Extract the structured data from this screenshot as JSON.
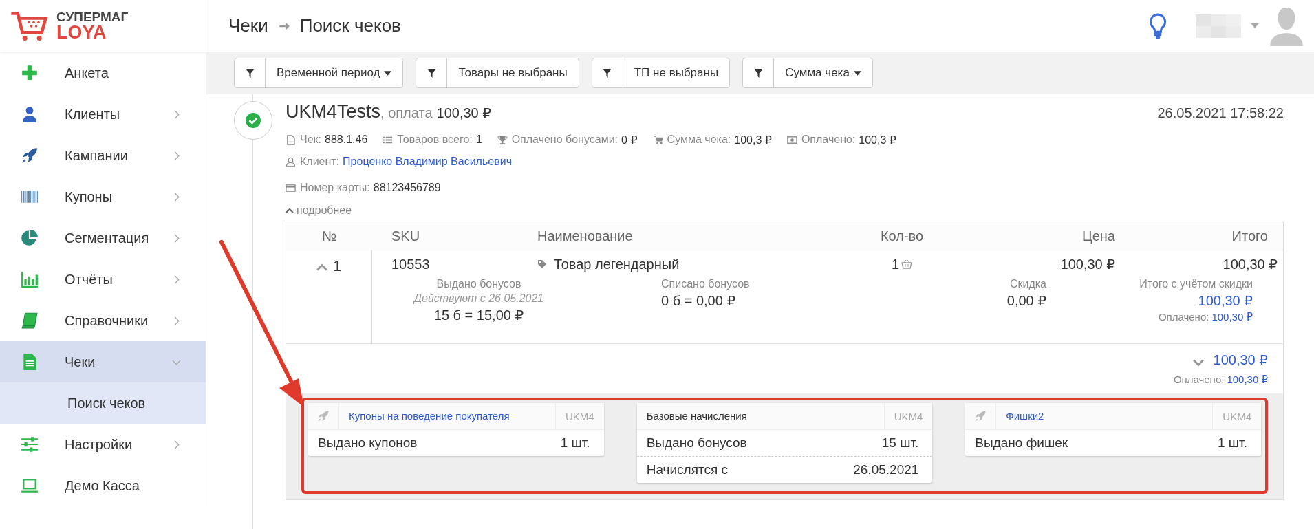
{
  "logo": {
    "line1": "СУПЕРМАГ",
    "line2": "LOYA"
  },
  "breadcrumb": [
    "Чеки",
    "Поиск чеков"
  ],
  "sidebar": {
    "items": [
      {
        "label": "Анкета",
        "selected": false
      },
      {
        "label": "Клиенты",
        "selected": false,
        "expanded": false
      },
      {
        "label": "Кампании",
        "selected": false,
        "expanded": false
      },
      {
        "label": "Купоны",
        "selected": false,
        "expanded": false
      },
      {
        "label": "Сегментация",
        "selected": false,
        "expanded": false
      },
      {
        "label": "Отчёты",
        "selected": false,
        "expanded": false
      },
      {
        "label": "Справочники",
        "selected": false,
        "expanded": false
      },
      {
        "label": "Чеки",
        "selected": true,
        "expanded": true,
        "children": [
          {
            "label": "Поиск чеков",
            "selected": true
          }
        ]
      },
      {
        "label": "Настройки",
        "selected": false,
        "expanded": false
      },
      {
        "label": "Демо Касса",
        "selected": false
      }
    ]
  },
  "filters": [
    {
      "label": "Временной период",
      "dropdown": true
    },
    {
      "label": "Товары не выбраны",
      "dropdown": false
    },
    {
      "label": "ТП не выбраны",
      "dropdown": false
    },
    {
      "label": "Сумма чека",
      "dropdown": true
    }
  ],
  "receipt": {
    "store": "UKM4Tests",
    "payment_label": ", оплата",
    "amount": "100,30 ₽",
    "datetime": "26.05.2021 17:58:22",
    "completed": true,
    "meta": [
      {
        "label": "Чек:",
        "value": "888.1.46"
      },
      {
        "label": "Товаров всего:",
        "value": "1"
      },
      {
        "label": "Оплачено бонусами:",
        "value": "0 ₽"
      },
      {
        "label": "Сумма чека:",
        "value": "100,3 ₽"
      },
      {
        "label": "Оплачено:",
        "value": "100,3 ₽"
      }
    ],
    "client": {
      "label": "Клиент:",
      "value": "Проценко Владимир Васильевич"
    },
    "card": {
      "label": "Номер карты:",
      "value": "88123456789"
    },
    "details_toggle": {
      "label": "подробнее",
      "expanded": true
    }
  },
  "table": {
    "columns": [
      "№",
      "SKU",
      "Наименование",
      "Кол-во",
      "Цена",
      "Итого"
    ],
    "rows": [
      {
        "expanded": true,
        "number": "1",
        "sku": "10553",
        "name": "Товар легендарный",
        "qty": "1",
        "price": "100,30 ₽",
        "total": "100,30 ₽",
        "issued_label": "Выдано бонусов",
        "issued_note": "Действуют с 26.05.2021",
        "issued_value": "15 б = 15,00 ₽",
        "written_label": "Списано бонусов",
        "written_value": "0 б = 0,00 ₽",
        "discount_label": "Скидка",
        "discount_value": "0,00 ₽",
        "final_label": "Итого с учётом скидки",
        "final_value": "100,30 ₽",
        "paid_label": "Оплачено:",
        "paid_value": "100,30 ₽"
      }
    ],
    "footer": {
      "expanded": false,
      "total": "100,30 ₽",
      "paid_label": "Оплачено:",
      "paid_value": "100,30 ₽"
    }
  },
  "cards": [
    {
      "kind": "campaign",
      "title": "Купоны на поведение покупателя",
      "tag": "UKM4",
      "rows": [
        {
          "label": "Выдано купонов",
          "value": "1 шт."
        }
      ]
    },
    {
      "kind": "base",
      "title": "Базовые начисления",
      "tag": "UKM4",
      "rows": [
        {
          "label": "Выдано бонусов",
          "value": "15 шт."
        },
        {
          "label": "Начислятся с",
          "value": "26.05.2021"
        }
      ]
    },
    {
      "kind": "campaign",
      "title": "Фишки2",
      "tag": "UKM4",
      "rows": [
        {
          "label": "Выдано фишек",
          "value": "1 шт."
        }
      ]
    }
  ]
}
